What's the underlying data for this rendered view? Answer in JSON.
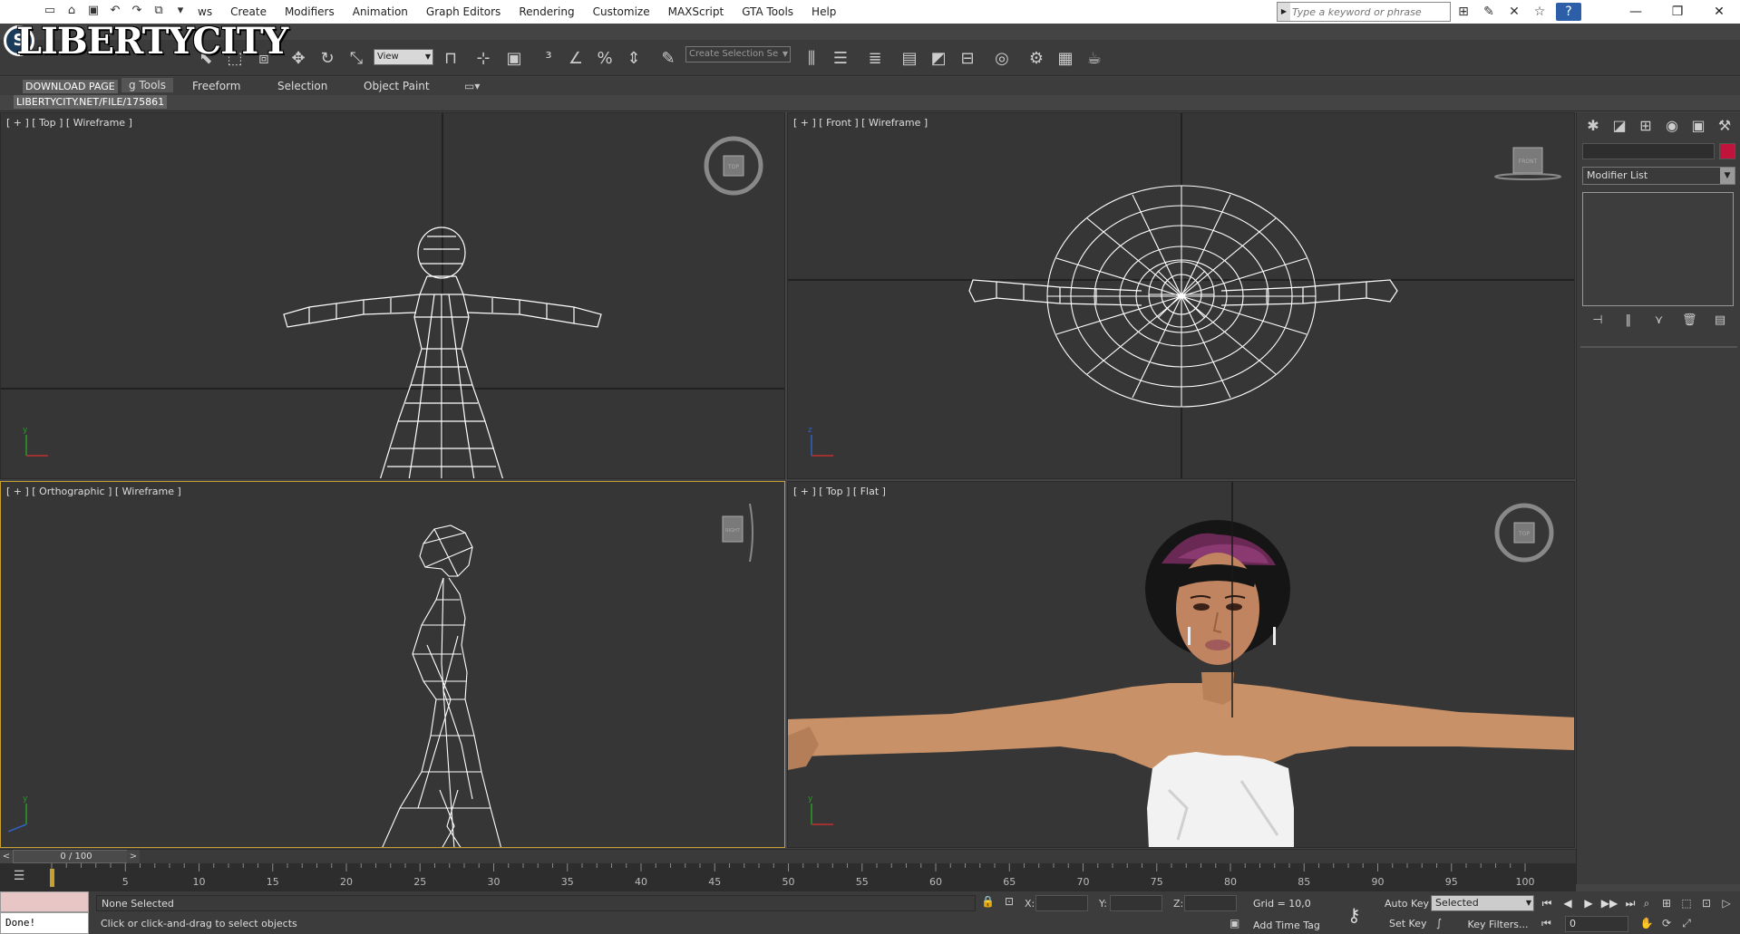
{
  "titlebar": {
    "menus": [
      "Create",
      "Modifiers",
      "Animation",
      "Graph Editors",
      "Rendering",
      "Customize",
      "MAXScript",
      "GTA Tools",
      "Help"
    ],
    "menu_partial": "ws",
    "search_placeholder": "Type a keyword or phrase",
    "window_controls": [
      "—",
      "❐",
      "✕"
    ]
  },
  "watermark": {
    "logo_text": "LIBERTYCITY",
    "download_label": "DOWNLOAD PAGE",
    "url": "LIBERTYCITY.NET/FILE/175861"
  },
  "toolbar": {
    "view_dropdown": "View",
    "selection_set_placeholder": "Create Selection Se"
  },
  "ribbon": {
    "tabs": [
      "g Tools",
      "Freeform",
      "Selection",
      "Object Paint"
    ]
  },
  "viewports": {
    "top_left": {
      "label": "[ + ] [ Top ] [ Wireframe ]",
      "navcube_label": "TOP"
    },
    "top_right": {
      "label": "[ + ] [ Front ] [ Wireframe ]",
      "navcube_label": "FRONT"
    },
    "bottom_left": {
      "label": "[ + ] [ Orthographic ] [ Wireframe ]",
      "navcube_label": "RIGHT"
    },
    "bottom_right": {
      "label": "[ + ] [ Top ] [ Flat ]",
      "navcube_label": "TOP"
    }
  },
  "command_panel": {
    "modifier_list": "Modifier List",
    "object_color": "#c0143c"
  },
  "time_slider": {
    "thumb_label": "0 / 100",
    "prev": "<",
    "next": ">"
  },
  "trackbar": {
    "ticks": [
      "5",
      "10",
      "15",
      "20",
      "25",
      "30",
      "35",
      "40",
      "45",
      "50",
      "55",
      "60",
      "65",
      "70",
      "75",
      "80",
      "85",
      "90",
      "95",
      "100"
    ]
  },
  "status": {
    "listener_output": "Done!",
    "selection": "None Selected",
    "prompt": "Click or click-and-drag to select objects",
    "x_label": "X:",
    "y_label": "Y:",
    "z_label": "Z:",
    "grid": "Grid = 10,0",
    "add_time_tag": "Add Time Tag",
    "auto_key": "Auto Key",
    "set_key": "Set Key",
    "selected_dropdown": "Selected",
    "key_filters": "Key Filters...",
    "frame_value": "0"
  }
}
